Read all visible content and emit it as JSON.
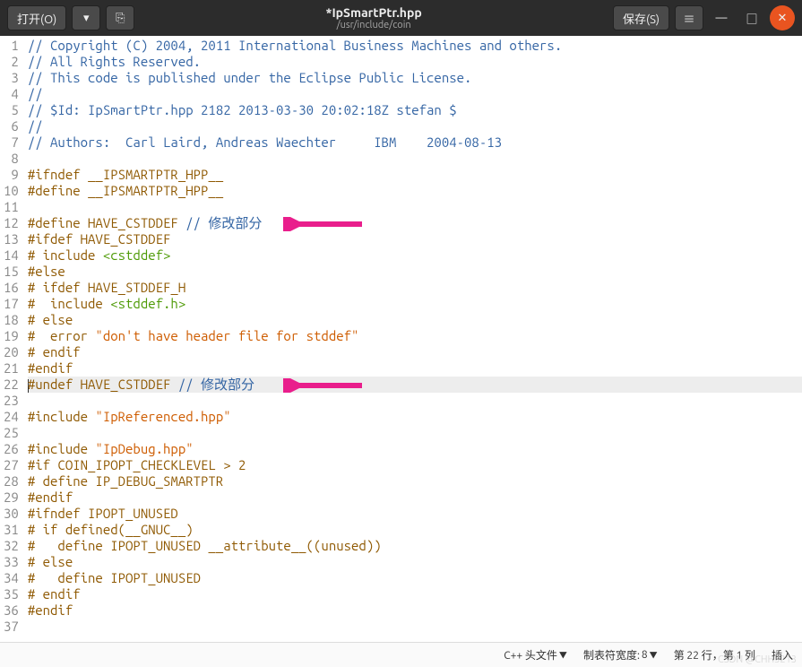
{
  "titlebar": {
    "open_label": "打开(O)",
    "save_label": "保存(S)",
    "title": "*IpSmartPtr.hpp",
    "subtitle": "/usr/include/coin"
  },
  "code": {
    "lines": [
      {
        "n": 1,
        "segs": [
          {
            "cls": "c-comment",
            "t": "// Copyright (C) 2004, 2011 International Business Machines and others."
          }
        ]
      },
      {
        "n": 2,
        "segs": [
          {
            "cls": "c-comment",
            "t": "// All Rights Reserved."
          }
        ]
      },
      {
        "n": 3,
        "segs": [
          {
            "cls": "c-comment",
            "t": "// This code is published under the Eclipse Public License."
          }
        ]
      },
      {
        "n": 4,
        "segs": [
          {
            "cls": "c-comment",
            "t": "//"
          }
        ]
      },
      {
        "n": 5,
        "segs": [
          {
            "cls": "c-comment",
            "t": "// $Id: IpSmartPtr.hpp 2182 2013-03-30 20:02:18Z stefan $"
          }
        ]
      },
      {
        "n": 6,
        "segs": [
          {
            "cls": "c-comment",
            "t": "//"
          }
        ]
      },
      {
        "n": 7,
        "segs": [
          {
            "cls": "c-comment",
            "t": "// Authors:  Carl Laird, Andreas Waechter     IBM    2004-08-13"
          }
        ]
      },
      {
        "n": 8,
        "segs": []
      },
      {
        "n": 9,
        "segs": [
          {
            "cls": "c-pre",
            "t": "#ifndef __IPSMARTPTR_HPP__"
          }
        ]
      },
      {
        "n": 10,
        "segs": [
          {
            "cls": "c-pre",
            "t": "#define __IPSMARTPTR_HPP__"
          }
        ]
      },
      {
        "n": 11,
        "segs": []
      },
      {
        "n": 12,
        "segs": [
          {
            "cls": "c-pre",
            "t": "#define HAVE_CSTDDEF "
          },
          {
            "cls": "c-comment",
            "t": "// 修改部分"
          }
        ],
        "arrow": true
      },
      {
        "n": 13,
        "segs": [
          {
            "cls": "c-pre",
            "t": "#ifdef HAVE_CSTDDEF"
          }
        ]
      },
      {
        "n": 14,
        "segs": [
          {
            "cls": "c-pre",
            "t": "# include "
          },
          {
            "cls": "c-inc",
            "t": "<cstddef>"
          }
        ]
      },
      {
        "n": 15,
        "segs": [
          {
            "cls": "c-pre",
            "t": "#else"
          }
        ]
      },
      {
        "n": 16,
        "segs": [
          {
            "cls": "c-pre",
            "t": "# ifdef HAVE_STDDEF_H"
          }
        ]
      },
      {
        "n": 17,
        "segs": [
          {
            "cls": "c-pre",
            "t": "#  include "
          },
          {
            "cls": "c-inc",
            "t": "<stddef.h>"
          }
        ]
      },
      {
        "n": 18,
        "segs": [
          {
            "cls": "c-pre",
            "t": "# else"
          }
        ]
      },
      {
        "n": 19,
        "segs": [
          {
            "cls": "c-pre",
            "t": "#  error "
          },
          {
            "cls": "c-str",
            "t": "\"don't have header file for stddef\""
          }
        ]
      },
      {
        "n": 20,
        "segs": [
          {
            "cls": "c-pre",
            "t": "# endif"
          }
        ]
      },
      {
        "n": 21,
        "segs": [
          {
            "cls": "c-pre",
            "t": "#endif"
          }
        ]
      },
      {
        "n": 22,
        "hl": true,
        "caret": true,
        "segs": [
          {
            "cls": "c-pre",
            "t": "#undef HAVE_CSTDDEF "
          },
          {
            "cls": "c-comment",
            "t": "// 修改部分"
          }
        ],
        "arrow": true
      },
      {
        "n": 23,
        "segs": []
      },
      {
        "n": 24,
        "segs": [
          {
            "cls": "c-pre",
            "t": "#include "
          },
          {
            "cls": "c-str",
            "t": "\"IpReferenced.hpp\""
          }
        ]
      },
      {
        "n": 25,
        "segs": []
      },
      {
        "n": 26,
        "segs": [
          {
            "cls": "c-pre",
            "t": "#include "
          },
          {
            "cls": "c-str",
            "t": "\"IpDebug.hpp\""
          }
        ]
      },
      {
        "n": 27,
        "segs": [
          {
            "cls": "c-pre",
            "t": "#if COIN_IPOPT_CHECKLEVEL > 2"
          }
        ]
      },
      {
        "n": 28,
        "segs": [
          {
            "cls": "c-pre",
            "t": "# define IP_DEBUG_SMARTPTR"
          }
        ]
      },
      {
        "n": 29,
        "segs": [
          {
            "cls": "c-pre",
            "t": "#endif"
          }
        ]
      },
      {
        "n": 30,
        "segs": [
          {
            "cls": "c-pre",
            "t": "#ifndef IPOPT_UNUSED"
          }
        ]
      },
      {
        "n": 31,
        "segs": [
          {
            "cls": "c-pre",
            "t": "# if defined(__GNUC__)"
          }
        ]
      },
      {
        "n": 32,
        "segs": [
          {
            "cls": "c-pre",
            "t": "#   define IPOPT_UNUSED __attribute__((unused))"
          }
        ]
      },
      {
        "n": 33,
        "segs": [
          {
            "cls": "c-pre",
            "t": "# else"
          }
        ]
      },
      {
        "n": 34,
        "segs": [
          {
            "cls": "c-pre",
            "t": "#   define IPOPT_UNUSED"
          }
        ]
      },
      {
        "n": 35,
        "segs": [
          {
            "cls": "c-pre",
            "t": "# endif"
          }
        ]
      },
      {
        "n": 36,
        "segs": [
          {
            "cls": "c-pre",
            "t": "#endif"
          }
        ]
      },
      {
        "n": 37,
        "segs": []
      }
    ]
  },
  "statusbar": {
    "language": "C++ 头文件",
    "tabwidth_label": "制表符宽度:",
    "tabwidth_value": "8",
    "position": "第 22 行，第 1 列",
    "mode": "插入"
  },
  "watermark": "CSDN @CHH3213"
}
